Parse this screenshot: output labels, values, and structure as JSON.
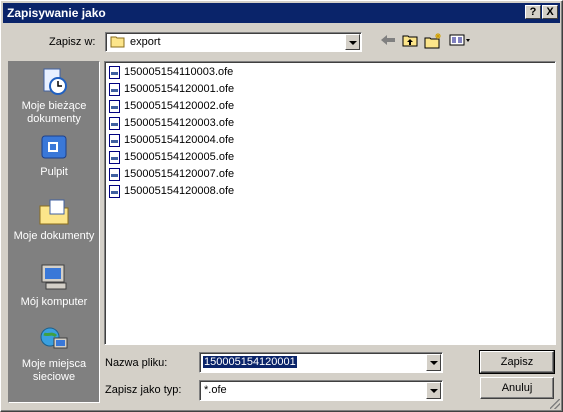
{
  "window": {
    "title": "Zapisywanie jako",
    "help_label": "?",
    "close_label": "X"
  },
  "save_in": {
    "label": "Zapisz w:",
    "value": "export"
  },
  "toolbar": {
    "back_icon": "back-arrow-icon",
    "up_icon": "up-folder-icon",
    "new_folder_icon": "new-folder-icon",
    "view_icon": "view-menu-icon"
  },
  "places": [
    {
      "label": "Moje bieżące dokumenty",
      "icon": "recent-documents-icon"
    },
    {
      "label": "Pulpit",
      "icon": "desktop-icon"
    },
    {
      "label": "Moje dokumenty",
      "icon": "my-documents-icon"
    },
    {
      "label": "Mój komputer",
      "icon": "my-computer-icon"
    },
    {
      "label": "Moje miejsca sieciowe",
      "icon": "network-places-icon"
    }
  ],
  "files": [
    "150005154110003.ofe",
    "150005154120001.ofe",
    "150005154120002.ofe",
    "150005154120003.ofe",
    "150005154120004.ofe",
    "150005154120005.ofe",
    "150005154120007.ofe",
    "150005154120008.ofe"
  ],
  "filename": {
    "label": "Nazwa pliku:",
    "value": "150005154120001"
  },
  "filetype": {
    "label": "Zapisz jako typ:",
    "value": "*.ofe"
  },
  "buttons": {
    "save": "Zapisz",
    "cancel": "Anuluj"
  }
}
